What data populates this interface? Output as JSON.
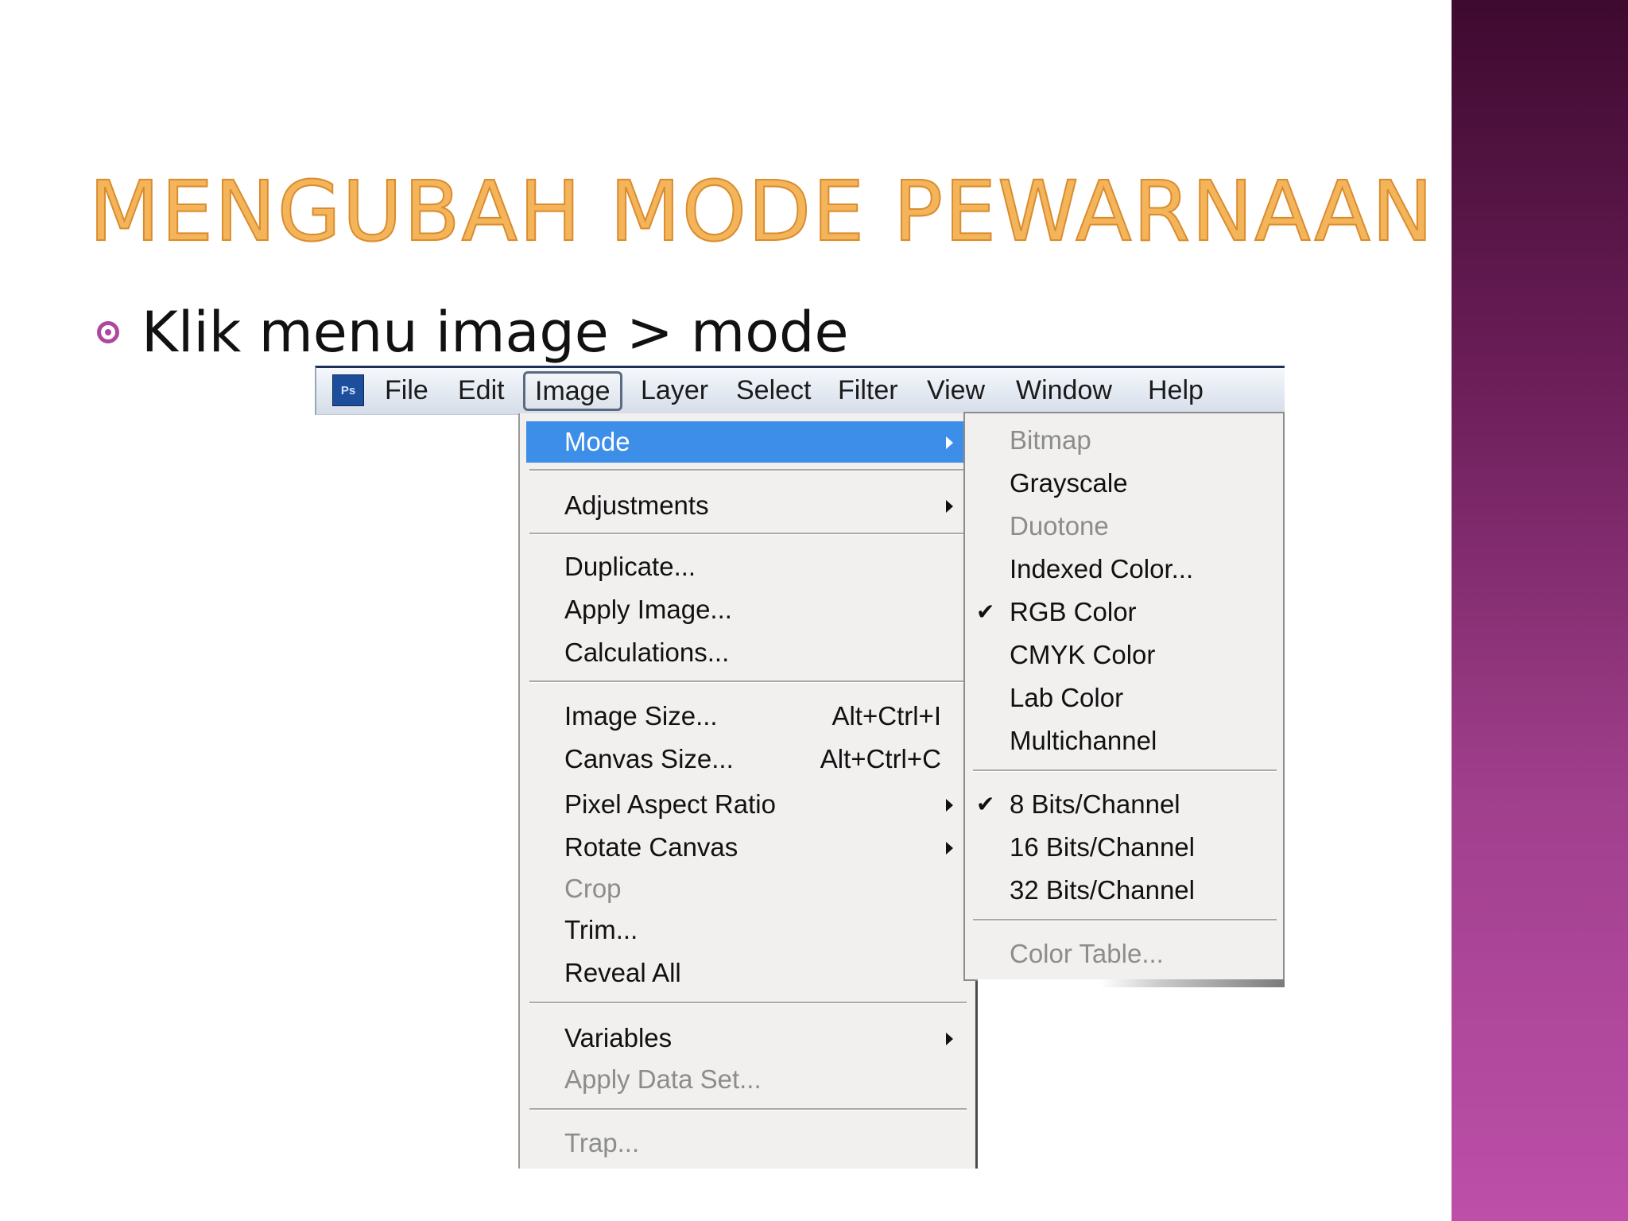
{
  "slide": {
    "title": "MENGUBAH MODE PEWARNAAN",
    "bullet": "Klik menu image > mode"
  },
  "menubar": {
    "logo": "Ps",
    "items": [
      "File",
      "Edit",
      "Image",
      "Layer",
      "Select",
      "Filter",
      "View",
      "Window",
      "Help"
    ],
    "active": "Image"
  },
  "image_menu": {
    "mode": "Mode",
    "adjustments": "Adjustments",
    "duplicate": "Duplicate...",
    "apply_image": "Apply Image...",
    "calculations": "Calculations...",
    "image_size": "Image Size...",
    "image_size_shortcut": "Alt+Ctrl+I",
    "canvas_size": "Canvas Size...",
    "canvas_size_shortcut": "Alt+Ctrl+C",
    "pixel_aspect_ratio": "Pixel Aspect Ratio",
    "rotate_canvas": "Rotate Canvas",
    "crop": "Crop",
    "trim": "Trim...",
    "reveal_all": "Reveal All",
    "variables": "Variables",
    "apply_data_set": "Apply Data Set...",
    "trap": "Trap..."
  },
  "mode_menu": {
    "bitmap": "Bitmap",
    "grayscale": "Grayscale",
    "duotone": "Duotone",
    "indexed_color": "Indexed Color...",
    "rgb_color": "RGB Color",
    "cmyk_color": "CMYK Color",
    "lab_color": "Lab Color",
    "multichannel": "Multichannel",
    "bits8": "8 Bits/Channel",
    "bits16": "16 Bits/Channel",
    "bits32": "32 Bits/Channel",
    "color_table": "Color Table...",
    "check_mark": "✔"
  },
  "colors": {
    "title_orange": "#f4b45a",
    "bullet_magenta": "#b0479c",
    "highlight_blue": "#3d8ee8"
  }
}
